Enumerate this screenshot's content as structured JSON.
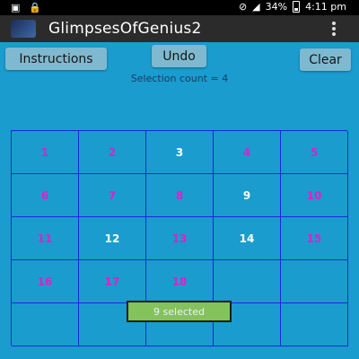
{
  "status_bar": {
    "battery": "34%",
    "time": "4:11 pm"
  },
  "app_bar": {
    "title": "GlimpsesOfGenius2"
  },
  "toolbar": {
    "instructions_label": "Instructions",
    "undo_label": "Undo",
    "clear_label": "Clear"
  },
  "selection_count_text": "Selection count = 4",
  "grid": {
    "cells": [
      {
        "label": "1",
        "selected": true
      },
      {
        "label": "2",
        "selected": true
      },
      {
        "label": "3",
        "selected": false
      },
      {
        "label": "4",
        "selected": true
      },
      {
        "label": "5",
        "selected": true
      },
      {
        "label": "6",
        "selected": true
      },
      {
        "label": "7",
        "selected": true
      },
      {
        "label": "8",
        "selected": true
      },
      {
        "label": "9",
        "selected": false
      },
      {
        "label": "10",
        "selected": true
      },
      {
        "label": "11",
        "selected": true
      },
      {
        "label": "12",
        "selected": false
      },
      {
        "label": "13",
        "selected": true
      },
      {
        "label": "14",
        "selected": false
      },
      {
        "label": "15",
        "selected": true
      },
      {
        "label": "16",
        "selected": true
      },
      {
        "label": "17",
        "selected": true
      },
      {
        "label": "18",
        "selected": true
      },
      {
        "label": "",
        "selected": false
      },
      {
        "label": "",
        "selected": false
      },
      {
        "label": "",
        "selected": false
      },
      {
        "label": "",
        "selected": false
      },
      {
        "label": "",
        "selected": false
      },
      {
        "label": "",
        "selected": false
      },
      {
        "label": "",
        "selected": false
      }
    ]
  },
  "toast_text": "9 selected",
  "colors": {
    "background": "#1a9ccf",
    "grid_line": "#1c28d8",
    "selected_number": "#e01fc9",
    "unselected_number": "#ffffff",
    "toast_background": "#84c35b"
  },
  "icons": {
    "status_left": [
      "image-icon",
      "lock-icon"
    ],
    "status_right": [
      "no-sim-icon",
      "signal-icon",
      "battery-icon"
    ],
    "app": "app-logo-icon",
    "menu": "overflow-menu-icon"
  }
}
